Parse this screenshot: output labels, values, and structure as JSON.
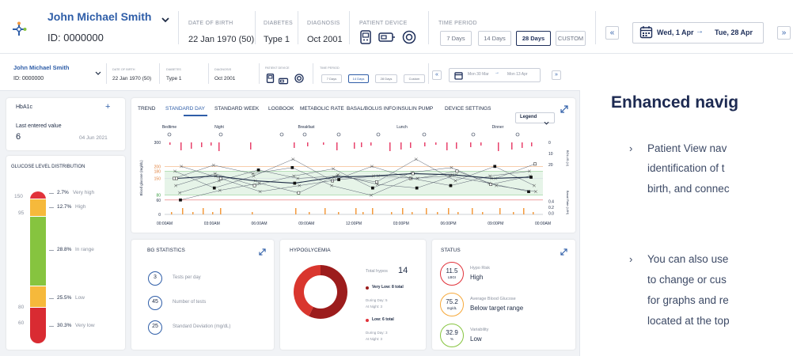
{
  "colors": {
    "brand": "#2f5ea8",
    "navy": "#1e2f5a",
    "very_high": "#e1323a",
    "high": "#f6b93b",
    "in_range": "#86c43f",
    "low": "#f6b93b",
    "very_low": "#d92b32",
    "hypo_dark": "#9c1c1c",
    "hypo_light": "#d9362e",
    "target_band": "#e6f4e8",
    "orange": "#f39a3e",
    "pink": "#e8416b"
  },
  "header": {
    "patient_name": "John Michael Smith",
    "patient_id": "ID: 0000000",
    "dob_label": "DATE OF BIRTH",
    "dob": "22 Jan 1970 (50)",
    "diabetes_label": "DIABETES",
    "diabetes": "Type 1",
    "diagnosis_label": "DIAGNOSIS",
    "diagnosis": "Oct 2001",
    "device_label": "PATIENT DEVICE",
    "period_label": "TIME PERIOD",
    "periods": [
      "7 Days",
      "14 Days",
      "28 Days",
      "CUSTOM"
    ],
    "selected_period": "28 Days",
    "date_range_start": "Wed, 1 Apr",
    "date_range_end": "Tue, 28 Apr",
    "prev_icon": "«",
    "next_icon": "»",
    "arrow": "→"
  },
  "mini_header": {
    "patient_name": "John Michael Smith",
    "patient_id": "ID: 0000000",
    "dob_label": "DATE OF BIRTH",
    "dob": "22 Jan 1970 (50)",
    "diabetes_label": "DIABETES",
    "diabetes": "Type 1",
    "diagnosis_label": "DIAGNOSIS",
    "diagnosis": "Oct 2001",
    "device_label": "PATIENT DEVICE",
    "period_label": "TIME PERIOD",
    "periods": [
      "7 Days",
      "14 Days",
      "28 Days",
      "Custom"
    ],
    "date_start": "Mon 30 Mar",
    "date_end": "Mon 13 Apr"
  },
  "hba1c": {
    "title": "HbA1c",
    "add": "+",
    "last_label": "Last entered value",
    "value": "6",
    "date": "04 Jun 2021"
  },
  "distribution": {
    "title": "GLUCOSE LEVEL DISTRIBUTION",
    "thresholds": [
      "150",
      "95",
      "80",
      "60"
    ],
    "segments": [
      {
        "pct": "2.7%",
        "label": "Very high",
        "share": 2.7
      },
      {
        "pct": "12.7%",
        "label": "High",
        "share": 12.7
      },
      {
        "pct": "28.8%",
        "label": "In range",
        "share": 28.8
      },
      {
        "pct": "25.5%",
        "label": "Low",
        "share": 25.5
      },
      {
        "pct": "30.3%",
        "label": "Very low",
        "share": 30.3
      }
    ]
  },
  "tabs": [
    "TREND",
    "STANDARD DAY",
    "STANDARD WEEK",
    "LOGBOOK",
    "METABOLIC RATE",
    "BASAL/BOLUS INFO",
    "INSULIN PUMP",
    "DEVICE SETTINGS"
  ],
  "active_tab": "STANDARD DAY",
  "legend_label": "Legend",
  "chart_data": {
    "type": "line",
    "meals": [
      "Bedtime",
      "Night",
      "Breakfast",
      "Lunch",
      "Dinner"
    ],
    "xlabel": "",
    "x_ticks": [
      "00:00AM",
      "03:00AM",
      "06:00AM",
      "09:00AM",
      "12:00PM",
      "03:00PM",
      "06:00PM",
      "09:00PM",
      "00:00AM"
    ],
    "ylabel": "Blood glucose (mg/dL)",
    "y_ticks": [
      "300",
      "200",
      "180",
      "150",
      "80",
      "60",
      "0"
    ],
    "y_ticks_right_bolus": [
      "0",
      "10",
      "20"
    ],
    "y_ticks_right_basal": [
      "0.4",
      "0.2",
      "0.0"
    ],
    "ylabel_right_top": "BOLUS (U)",
    "ylabel_right_bottom": "Basal Rate (U/H)",
    "ylim": [
      0,
      300
    ],
    "target_range": [
      80,
      180
    ],
    "series": [
      {
        "values": [
          150,
          205,
          170,
          195,
          120,
          80,
          150,
          160,
          130,
          95
        ]
      },
      {
        "values": [
          90,
          140,
          185,
          150,
          160,
          135,
          230,
          140,
          200,
          120
        ]
      },
      {
        "values": [
          180,
          110,
          160,
          230,
          140,
          200,
          150,
          120,
          160,
          180
        ]
      },
      {
        "values": [
          60,
          100,
          130,
          90,
          165,
          125,
          110,
          165,
          150,
          210
        ]
      },
      {
        "values": [
          120,
          170,
          120,
          160,
          190,
          110,
          175,
          195,
          125,
          160
        ]
      },
      {
        "values": [
          200,
          150,
          95,
          120,
          145,
          160,
          150,
          180,
          120,
          95
        ]
      },
      {
        "values": [
          150,
          160,
          140,
          130,
          155,
          160,
          170,
          165,
          150,
          155
        ]
      }
    ]
  },
  "bg_stats": {
    "title": "BG STATISTICS",
    "rows": [
      {
        "value": "3",
        "label": "Tests per day"
      },
      {
        "value": "45",
        "label": "Number of tests"
      },
      {
        "value": "25",
        "label": "Standard Deviation (mg/dL)"
      }
    ]
  },
  "hypo": {
    "title": "HYPOGLYCEMIA",
    "total_label": "Total hypos",
    "total": "14",
    "very_low": "Very Low: 8 total",
    "very_low_day": "During Day: 5",
    "very_low_night": "At Night: 3",
    "low": "Low: 6 total",
    "low_day": "During Day: 3",
    "low_night": "At Night: 3",
    "donut": [
      {
        "name": "Very Low",
        "value": 8
      },
      {
        "name": "Low",
        "value": 6
      }
    ]
  },
  "status": {
    "title": "STATUS",
    "items": [
      {
        "value": "11.5",
        "unit": "LBGI",
        "label": "Hypo Risk",
        "text": "High",
        "color": "#e1323a"
      },
      {
        "value": "75.2",
        "unit": "mg/dL",
        "label": "Average Blood Glucose",
        "text": "Below target range",
        "color": "#f6a93b"
      },
      {
        "value": "32.9",
        "unit": "%",
        "label": "Variability",
        "text": "Low",
        "color": "#86c43f"
      }
    ]
  },
  "side": {
    "headline": "Enhanced navig",
    "bullet1_line1": "Patient View nav",
    "bullet1_line2": "identification of t",
    "bullet1_line3": "birth, and connec",
    "bullet2_line1": "You can also use",
    "bullet2_line2": "to change or cus",
    "bullet2_line3": "for graphs and re",
    "bullet2_line4": "located at the top",
    "chevron": "›"
  }
}
